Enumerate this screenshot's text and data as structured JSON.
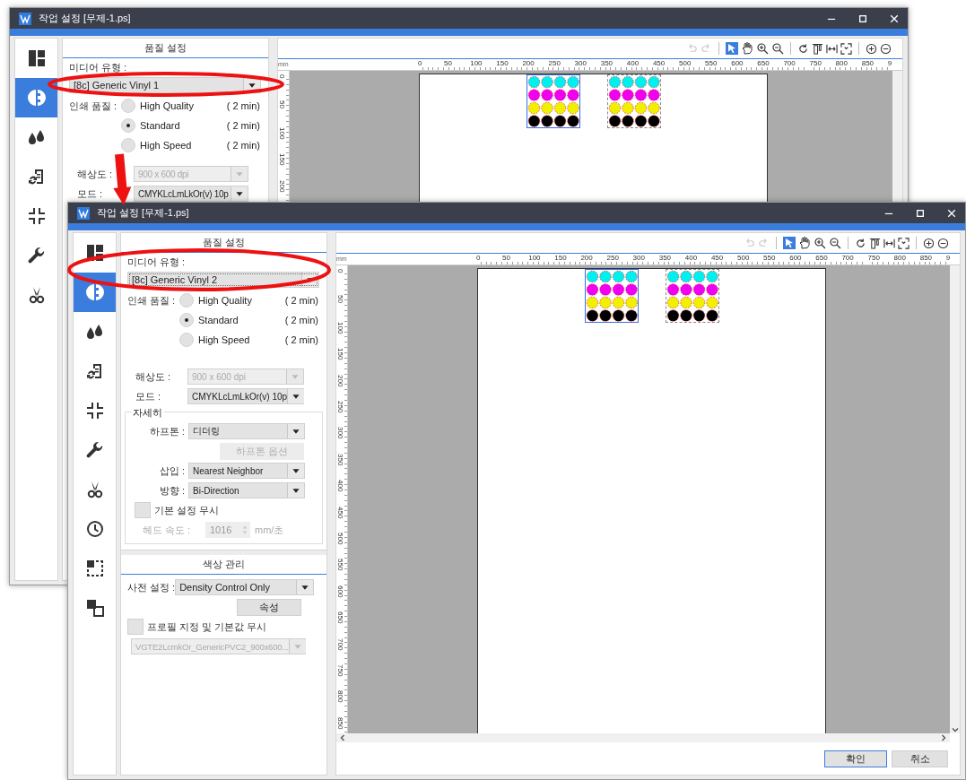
{
  "windows": [
    {
      "title": "작업 설정 [무제-1.ps]",
      "sidebar": [
        {
          "selected": false
        },
        {
          "selected": true
        },
        {
          "selected": false
        },
        {
          "selected": false
        },
        {
          "selected": false
        },
        {
          "selected": false
        },
        {
          "selected": false
        }
      ],
      "panel": {
        "header": "품질 설정",
        "media_label": "미디어 유형 :",
        "media_value": "[8c] Generic Vinyl 1",
        "media_focused": false,
        "quality_label": "인쇄 품질 :",
        "quality_options": [
          {
            "label": "High Quality",
            "time": "( 2 min)",
            "selected": false
          },
          {
            "label": "Standard",
            "time": "( 2 min)",
            "selected": true
          },
          {
            "label": "High Speed",
            "time": "( 2 min)",
            "selected": false
          }
        ],
        "resolution": {
          "label": "해상도 :",
          "value": "900 x 600 dpi",
          "disabled": true
        },
        "mode": {
          "label": "모드 :",
          "value": "CMYKLcLmLkOr(v) 10p",
          "disabled": false
        }
      },
      "canvas": {
        "unit": "mm",
        "h_ruler": [
          "0",
          "50",
          "100",
          "150",
          "200",
          "250",
          "300",
          "350",
          "400",
          "450",
          "500",
          "550",
          "600",
          "650",
          "700",
          "750",
          "800",
          "850",
          "9"
        ],
        "v_ruler": [
          "0",
          "50",
          "100",
          "150",
          "200"
        ],
        "history": [
          {
            "disabled": true
          },
          {
            "disabled": true
          }
        ],
        "tools": [
          {
            "selected": true
          },
          {
            "selected": false
          },
          {
            "selected": false
          },
          {
            "selected": false
          }
        ],
        "objects": [
          {
            "selected": true
          },
          {
            "selected": false
          }
        ]
      }
    },
    {
      "title": "작업 설정 [무제-1.ps]",
      "sidebar": [
        {
          "selected": false
        },
        {
          "selected": true
        },
        {
          "selected": false
        },
        {
          "selected": false
        },
        {
          "selected": false
        },
        {
          "selected": false
        },
        {
          "selected": false
        },
        {
          "selected": false
        },
        {
          "selected": false
        },
        {
          "selected": false
        }
      ],
      "panel": {
        "header": "품질 설정",
        "media_label": "미디어 유형 :",
        "media_value": "[8c] Generic Vinyl 2",
        "media_focused": true,
        "quality_label": "인쇄 품질 :",
        "quality_options": [
          {
            "label": "High Quality",
            "time": "( 2 min)",
            "selected": false
          },
          {
            "label": "Standard",
            "time": "( 2 min)",
            "selected": true
          },
          {
            "label": "High Speed",
            "time": "( 2 min)",
            "selected": false
          }
        ],
        "resolution": {
          "label": "해상도 :",
          "value": "900 x 600 dpi",
          "disabled": true
        },
        "mode": {
          "label": "모드 :",
          "value": "CMYKLcLmLkOr(v) 10p",
          "disabled": false
        },
        "detail": {
          "title": "자세히",
          "halftone": {
            "label": "하프톤 :",
            "value": "디더링",
            "disabled": false
          },
          "halftone_options": {
            "label": "하프톤 옵션",
            "disabled": true
          },
          "interpolation": {
            "label": "삽입 :",
            "value": "Nearest Neighbor",
            "disabled": false
          },
          "direction": {
            "label": "방향 :",
            "value": "Bi-Direction",
            "disabled": false
          },
          "ignore_default": {
            "label": "기본 설정 무시",
            "checked": false
          },
          "head_speed": {
            "label": "헤드 속도 :",
            "value": "1016",
            "unit": "mm/초",
            "disabled": true
          }
        },
        "color": {
          "header": "색상 관리",
          "preset": {
            "label": "사전 설정 :",
            "value": "Density Control Only",
            "disabled": false
          },
          "properties": {
            "label": "속성",
            "disabled": false
          },
          "ignore_profile": {
            "label": "프로필 지정 및 기본값 무시",
            "checked": false
          },
          "profile": {
            "value": "VGTE2LcmkOr_GenericPVC2_900x600...",
            "disabled": true
          }
        }
      },
      "canvas": {
        "unit": "mm",
        "h_ruler": [
          "0",
          "50",
          "100",
          "150",
          "200",
          "250",
          "300",
          "350",
          "400",
          "450",
          "500",
          "550",
          "600",
          "650",
          "700",
          "750",
          "800",
          "850",
          "9"
        ],
        "v_ruler": [
          "0",
          "50",
          "100",
          "150",
          "200",
          "250",
          "300",
          "350",
          "400",
          "450",
          "500",
          "550",
          "600",
          "650",
          "700",
          "750",
          "800",
          "850"
        ],
        "history": [
          {
            "disabled": true
          },
          {
            "disabled": true
          }
        ],
        "tools": [
          {
            "selected": true
          },
          {
            "selected": false
          },
          {
            "selected": false
          },
          {
            "selected": false
          }
        ],
        "objects": [
          {
            "selected": true
          },
          {
            "selected": false
          }
        ]
      },
      "buttons": [
        {
          "label": "확인",
          "kind": "default"
        },
        {
          "label": "취소",
          "kind": "normal"
        }
      ]
    }
  ],
  "annotations": [
    {
      "kind": "ellipse"
    },
    {
      "kind": "ellipse"
    },
    {
      "kind": "arrow"
    }
  ]
}
